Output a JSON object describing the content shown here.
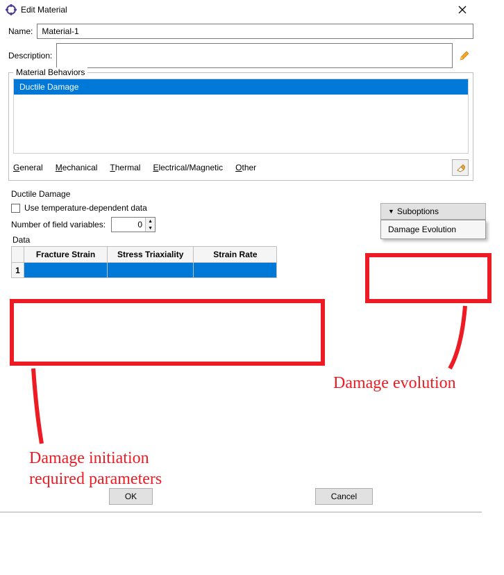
{
  "titlebar": {
    "title": "Edit Material"
  },
  "form": {
    "name_label": "Name:",
    "name_value": "Material-1",
    "description_label": "Description:"
  },
  "behaviors": {
    "legend": "Material Behaviors",
    "items": [
      "Ductile Damage"
    ],
    "selected_index": 0
  },
  "menus": {
    "general": "General",
    "mechanical": "Mechanical",
    "thermal": "Thermal",
    "electrical": "Electrical/Magnetic",
    "other": "Other"
  },
  "ductile": {
    "heading": "Ductile Damage",
    "temp_checkbox_label": "Use temperature-dependent data",
    "temp_checked": false,
    "fieldvars_label": "Number of field variables:",
    "fieldvars_value": "0",
    "data_label": "Data",
    "columns": [
      "Fracture Strain",
      "Stress Triaxiality",
      "Strain Rate"
    ],
    "rows": [
      {
        "num": "1",
        "cells": [
          "",
          "",
          ""
        ]
      }
    ]
  },
  "suboptions": {
    "button_label": "Suboptions",
    "menu_items": [
      "Damage Evolution"
    ]
  },
  "buttons": {
    "ok": "OK",
    "cancel": "Cancel"
  },
  "annotations": {
    "left_text": "Damage initiation\nrequired parameters",
    "right_text": "Damage evolution"
  },
  "colors": {
    "selection": "#0078d7",
    "annotation": "#ed1c24"
  }
}
